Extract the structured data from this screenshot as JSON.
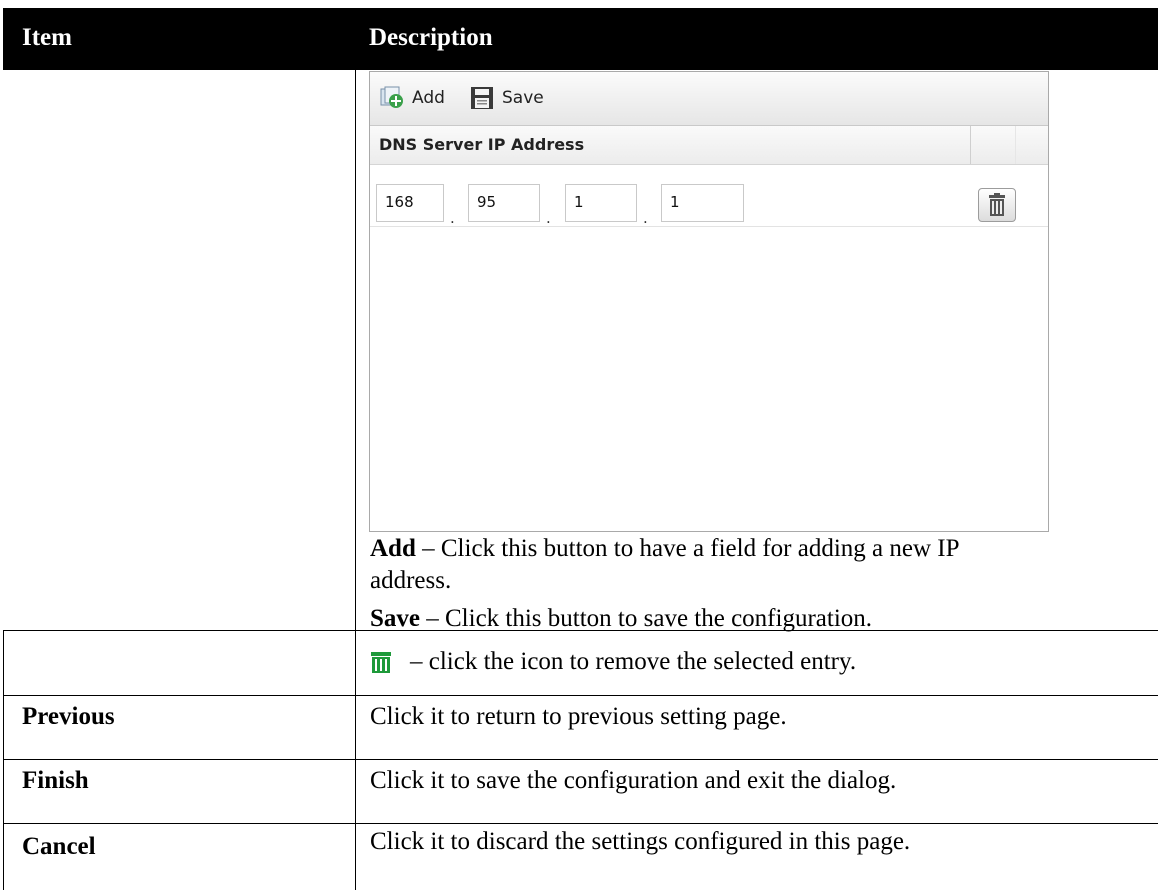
{
  "header": {
    "item": "Item",
    "description": "Description"
  },
  "panel": {
    "toolbar": {
      "add_label": "Add",
      "save_label": "Save"
    },
    "column_header": "DNS Server IP Address",
    "ip_octets": [
      "168",
      "95",
      "1",
      "1"
    ]
  },
  "desc": {
    "add_term": "Add",
    "add_text": " – Click this button to have a field for adding a new IP",
    "add_text2": "address.",
    "save_term": "Save",
    "save_text": " – Click this button to save the configuration.",
    "trash_text": "– click the icon to remove the selected entry."
  },
  "rows": [
    {
      "item": "Previous",
      "description": "Click it to return to previous setting page."
    },
    {
      "item": "Finish",
      "description": "Click it to save the configuration and exit the dialog."
    },
    {
      "item": "Cancel",
      "description": "Click it to discard the settings configured in this page."
    }
  ],
  "colors": {
    "header_bg": "#000000",
    "add_icon": "#3aa04a",
    "trash_icon": "#1e9a3a"
  }
}
